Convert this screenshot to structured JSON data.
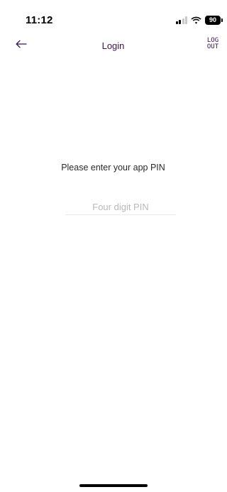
{
  "status_bar": {
    "time": "11:12",
    "battery": "90",
    "icons": [
      "signal-icon",
      "wifi-icon",
      "battery-icon"
    ]
  },
  "nav": {
    "back_icon": "arrow-left-icon",
    "title": "Login",
    "logout_line1": "LOG",
    "logout_line2": "OUT"
  },
  "main": {
    "prompt": "Please enter your app PIN",
    "pin_placeholder": "Four digit PIN",
    "pin_value": ""
  },
  "colors": {
    "accent": "#3b1350",
    "divider": "#ececec",
    "placeholder": "#b9b9b9"
  }
}
